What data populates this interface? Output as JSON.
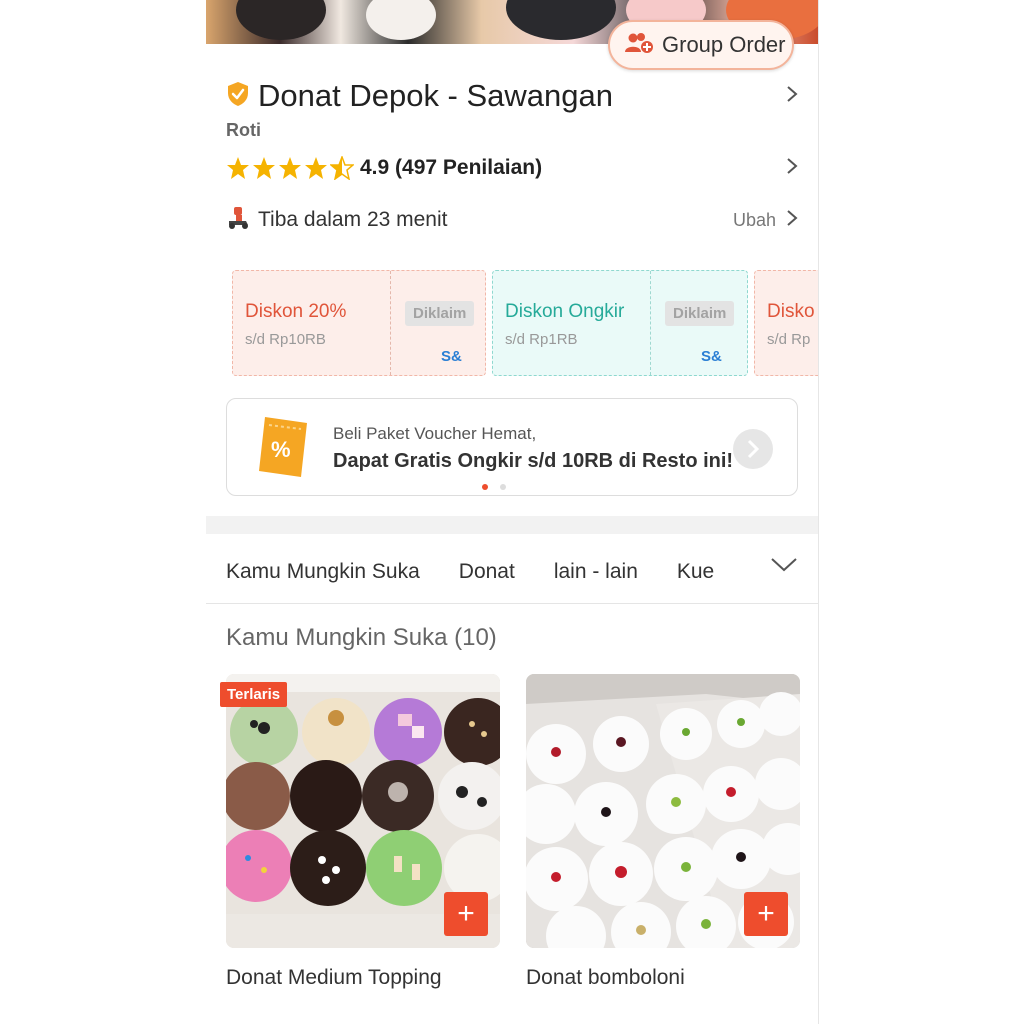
{
  "group_order": {
    "label": "Group Order",
    "icon": "group-add-icon"
  },
  "shop": {
    "name": "Donat Depok - Sawangan",
    "verified_icon": "verified-shield-icon",
    "category": "Roti",
    "rating": 4.9,
    "rating_text": "4.9 (497 Penilaian)",
    "stars_filled": 4.5
  },
  "delivery": {
    "text": "Tiba dalam 23 menit",
    "change_label": "Ubah",
    "icon": "delivery-scooter-icon"
  },
  "vouchers": [
    {
      "title": "Diskon 20%",
      "subtitle": "s/d Rp10RB",
      "status": "Diklaim",
      "tag": "S&",
      "color": "#e0553a"
    },
    {
      "title": "Diskon Ongkir",
      "subtitle": "s/d Rp1RB",
      "status": "Diklaim",
      "tag": "S&",
      "color": "#26aa99"
    },
    {
      "title": "Disko",
      "subtitle": "s/d Rp",
      "status": "",
      "tag": "",
      "color": "#e0553a"
    }
  ],
  "promo": {
    "line1": "Beli Paket Voucher Hemat,",
    "line2": "Dapat Gratis Ongkir s/d 10RB di Resto ini!",
    "icon": "voucher-ticket-icon"
  },
  "tabs": [
    "Kamu Mungkin Suka",
    "Donat",
    "lain - lain",
    "Kue"
  ],
  "section": {
    "title": "Kamu Mungkin Suka (10)"
  },
  "products": [
    {
      "name": "Donat Medium Topping",
      "badge": "Terlaris"
    },
    {
      "name": "Donat bomboloni",
      "badge": ""
    }
  ],
  "colors": {
    "accent": "#ee4d2d",
    "star": "#f5b301",
    "teal": "#26aa99"
  }
}
